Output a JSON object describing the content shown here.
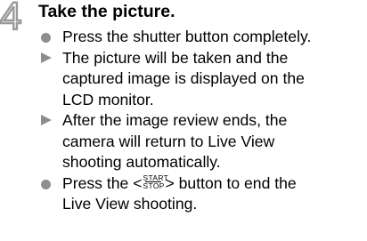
{
  "step": {
    "number": "4",
    "title": "Take the picture."
  },
  "items": [
    {
      "bullet": "circle",
      "lines": [
        "Press the shutter button completely."
      ]
    },
    {
      "bullet": "triangle",
      "lines": [
        "The picture will be taken and the",
        "captured image is displayed on the",
        "LCD monitor."
      ]
    },
    {
      "bullet": "triangle",
      "lines": [
        "After the image review ends, the",
        "camera will return to Live View",
        "shooting automatically."
      ]
    },
    {
      "bullet": "circle",
      "before": "Press the <",
      "button_top": "START",
      "button_bottom": "STOP",
      "after": "> button to end the",
      "continuation": "Live View shooting."
    }
  ],
  "colors": {
    "bullet": "#8e8e8e",
    "step_number_outline": "#9a9a9a",
    "text": "#000000"
  }
}
